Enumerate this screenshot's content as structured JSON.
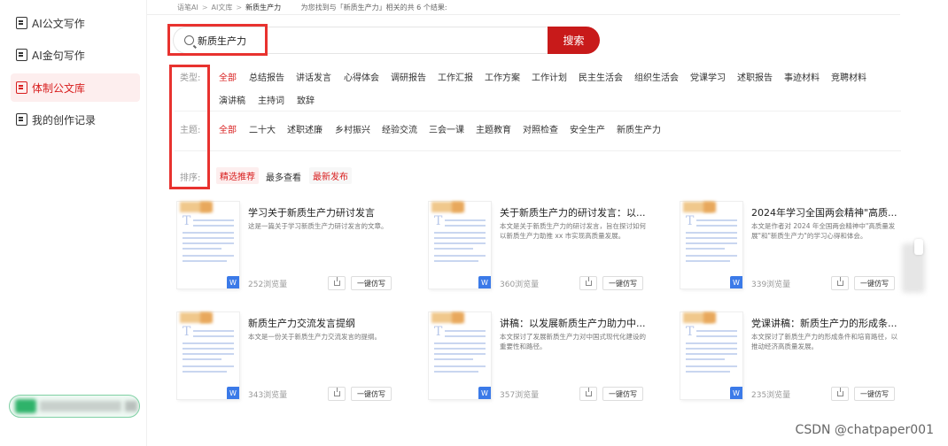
{
  "sidebar": {
    "items": [
      {
        "label": "AI公文写作"
      },
      {
        "label": "AI金句写作"
      },
      {
        "label": "体制公文库"
      },
      {
        "label": "我的创作记录"
      }
    ]
  },
  "breadcrumb": {
    "items": [
      "语笔AI",
      "AI文库",
      "新质生产力"
    ],
    "result_note": "为您找到与「新质生产力」相关的共 6 个结果:"
  },
  "search": {
    "value": "新质生产力",
    "button_label": "搜索"
  },
  "filters": {
    "type": {
      "label": "类型:",
      "options": [
        "全部",
        "总结报告",
        "讲话发言",
        "心得体会",
        "调研报告",
        "工作汇报",
        "工作方案",
        "工作计划",
        "民主生活会",
        "组织生活会",
        "党课学习",
        "述职报告",
        "事迹材料",
        "竞聘材料",
        "演讲稿",
        "主持词",
        "致辞"
      ]
    },
    "topic": {
      "label": "主题:",
      "options": [
        "全部",
        "二十大",
        "述职述廉",
        "乡村振兴",
        "经验交流",
        "三会一课",
        "主题教育",
        "对照检查",
        "安全生产",
        "新质生产力"
      ]
    },
    "sort": {
      "label": "排序:",
      "options": [
        "精选推荐",
        "最多查看",
        "最新发布"
      ]
    }
  },
  "cards": [
    {
      "title": "学习关于新质生产力研讨发言",
      "desc": "这是一篇关于学习新质生产力研讨发言的文章。",
      "views": "252浏览量",
      "action": "一键仿写"
    },
    {
      "title": "关于新质生产力的研讨发言：以...",
      "desc": "本文是关于新质生产力的研讨发言，旨在探讨如何以新质生产力助推 xx 市实现高质量发展。",
      "views": "360浏览量",
      "action": "一键仿写"
    },
    {
      "title": "2024年学习全国两会精神\"高质...",
      "desc": "本文是作者对 2024 年全国两会精神中\"高质量发展\"和\"新质生产力\"的学习心得和体会。",
      "views": "339浏览量",
      "action": "一键仿写"
    },
    {
      "title": "新质生产力交流发言提纲",
      "desc": "本文是一份关于新质生产力交流发言的提纲。",
      "views": "343浏览量",
      "action": "一键仿写"
    },
    {
      "title": "讲稿：以发展新质生产力助力中...",
      "desc": "本文探讨了发展新质生产力对中国式现代化建设的重要性和路径。",
      "views": "357浏览量",
      "action": "一键仿写"
    },
    {
      "title": "党课讲稿：新质生产力的形成条...",
      "desc": "本文探讨了新质生产力的形成条件和培育路径，以推动经济高质量发展。",
      "views": "235浏览量",
      "action": "一键仿写"
    }
  ],
  "thumb": {
    "letter": "T",
    "badge": "W"
  },
  "watermark": "CSDN @chatpaper001",
  "colors": {
    "accent": "#c81a1a",
    "highlight_box": "#e8322f",
    "active_bg": "#fdeeee"
  }
}
